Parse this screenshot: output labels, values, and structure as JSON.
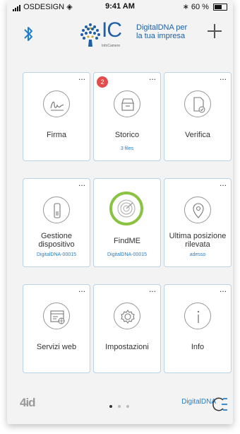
{
  "statusbar": {
    "carrier": "OSDESIGN",
    "time": "9:41 AM",
    "battery": "60 %",
    "battery_level": 0.6
  },
  "header": {
    "logo_text": "IC",
    "logo_subtext": "InfoCamere",
    "title": "DigitalDNA per la tua impresa"
  },
  "tiles": [
    {
      "label": "Firma",
      "sub": "",
      "icon": "signature-icon"
    },
    {
      "label": "Storico",
      "sub": "3 files",
      "badge": "2",
      "icon": "archive-icon"
    },
    {
      "label": "Verifica",
      "sub": "",
      "icon": "document-check-icon"
    },
    {
      "label": "Gestione dispositivo",
      "sub": "DigitalDNA-00015",
      "icon": "device-icon"
    },
    {
      "label": "FindME",
      "sub": "DigitalDNA-00015",
      "icon": "radar-icon"
    },
    {
      "label": "Ultima posizione rilevata",
      "sub": "adesso",
      "icon": "location-pin-icon"
    },
    {
      "label": "Servizi web",
      "sub": "",
      "icon": "browser-globe-icon"
    },
    {
      "label": "Impostazioni",
      "sub": "",
      "icon": "gear-icon"
    },
    {
      "label": "Info",
      "sub": "",
      "icon": "info-icon"
    }
  ],
  "tile_more": "...",
  "footer": {
    "left_logo": "4id",
    "brand": "DigitalDNA",
    "pages": 3,
    "current_page": 1
  },
  "colors": {
    "accent": "#1f7fd0",
    "logo_blue": "#1f5fa8",
    "findme_ring": "#8ac242",
    "badge": "#e44b4b",
    "tile_border": "#b9d3ea"
  }
}
